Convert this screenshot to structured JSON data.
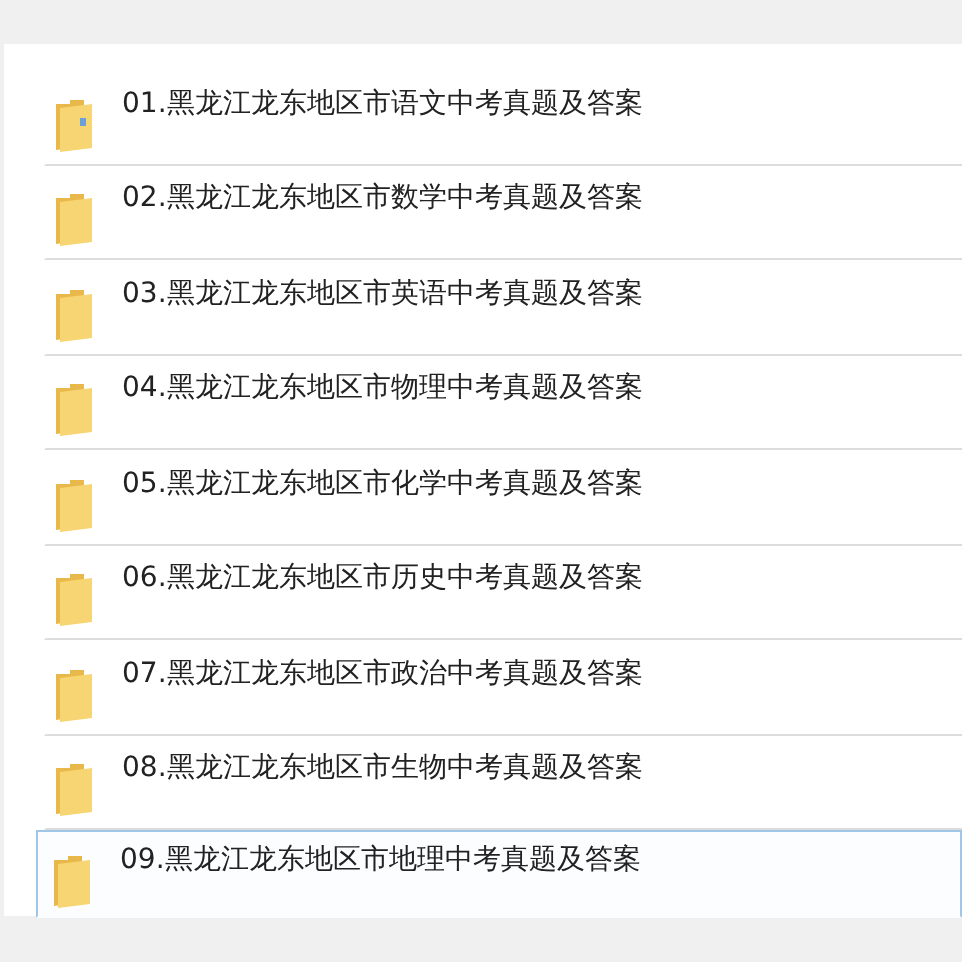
{
  "folders": [
    {
      "name": "01.黑龙江龙东地区市语文中考真题及答案",
      "kind": "folder-with-file",
      "selected": false
    },
    {
      "name": "02.黑龙江龙东地区市数学中考真题及答案",
      "kind": "folder",
      "selected": false
    },
    {
      "name": "03.黑龙江龙东地区市英语中考真题及答案",
      "kind": "folder",
      "selected": false
    },
    {
      "name": "04.黑龙江龙东地区市物理中考真题及答案",
      "kind": "folder",
      "selected": false
    },
    {
      "name": "05.黑龙江龙东地区市化学中考真题及答案",
      "kind": "folder",
      "selected": false
    },
    {
      "name": "06.黑龙江龙东地区市历史中考真题及答案",
      "kind": "folder",
      "selected": false
    },
    {
      "name": "07.黑龙江龙东地区市政治中考真题及答案",
      "kind": "folder",
      "selected": false
    },
    {
      "name": "08.黑龙江龙东地区市生物中考真题及答案",
      "kind": "folder",
      "selected": false
    },
    {
      "name": "09.黑龙江龙东地区市地理中考真题及答案",
      "kind": "folder",
      "selected": true
    }
  ]
}
